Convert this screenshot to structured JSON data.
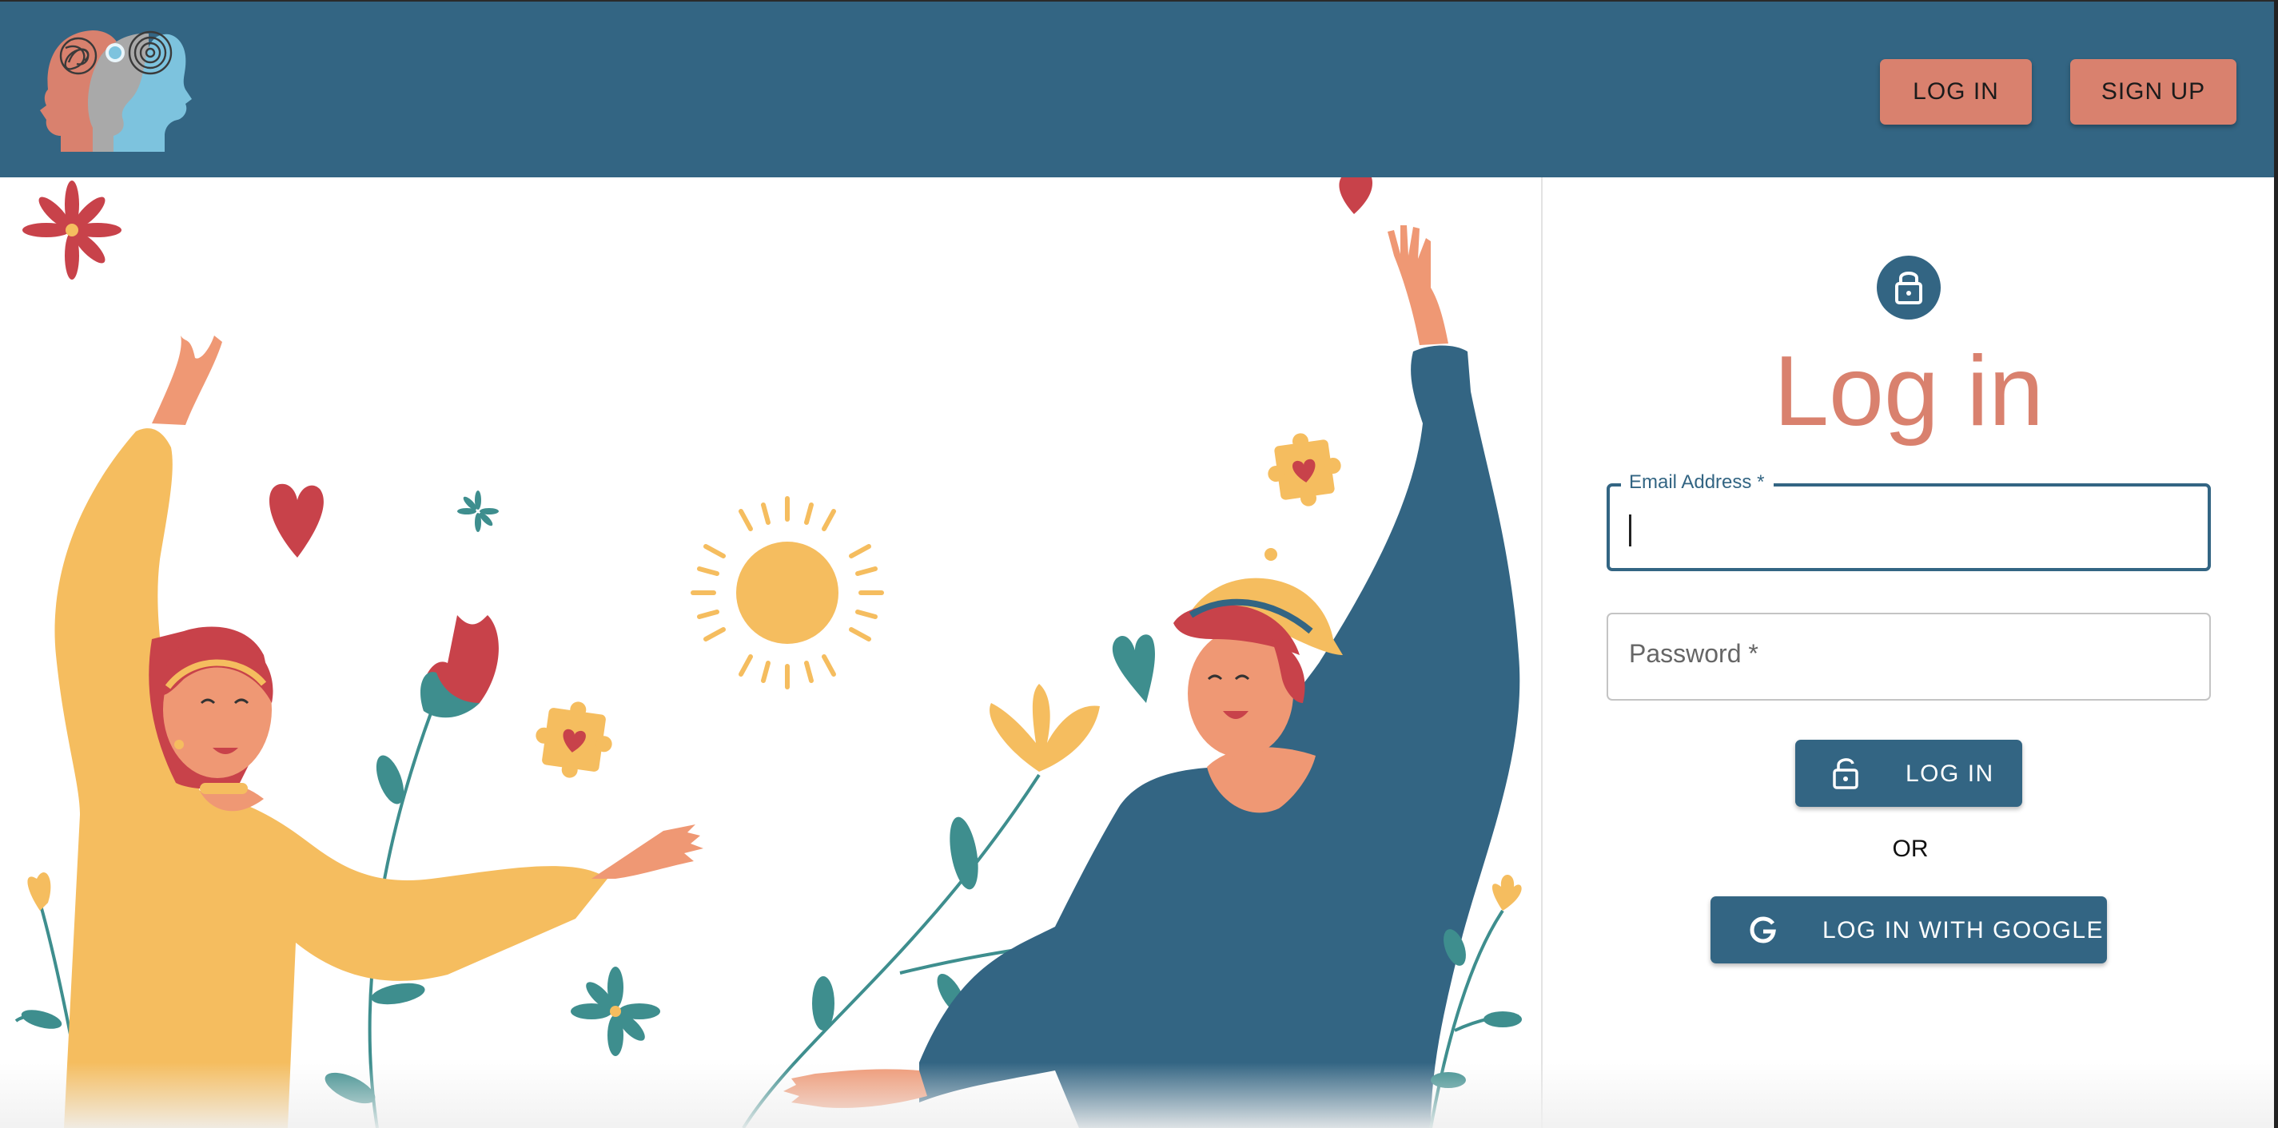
{
  "header": {
    "login_label": "LOG IN",
    "signup_label": "SIGN UP"
  },
  "login_panel": {
    "title": "Log in",
    "email_label": "Email Address *",
    "email_value": "",
    "password_label": "Password *",
    "password_value": "",
    "login_button_label": "LOG IN",
    "or_text": "OR",
    "google_button_label": "LOG IN WITH GOOGLE"
  },
  "colors": {
    "header_bg": "#336583",
    "accent_coral": "#d9816e",
    "yellow": "#f5bd5f",
    "red": "#c8424a",
    "skin": "#ef9874"
  },
  "icons": [
    "logo-heads",
    "lock-icon",
    "google-icon"
  ]
}
